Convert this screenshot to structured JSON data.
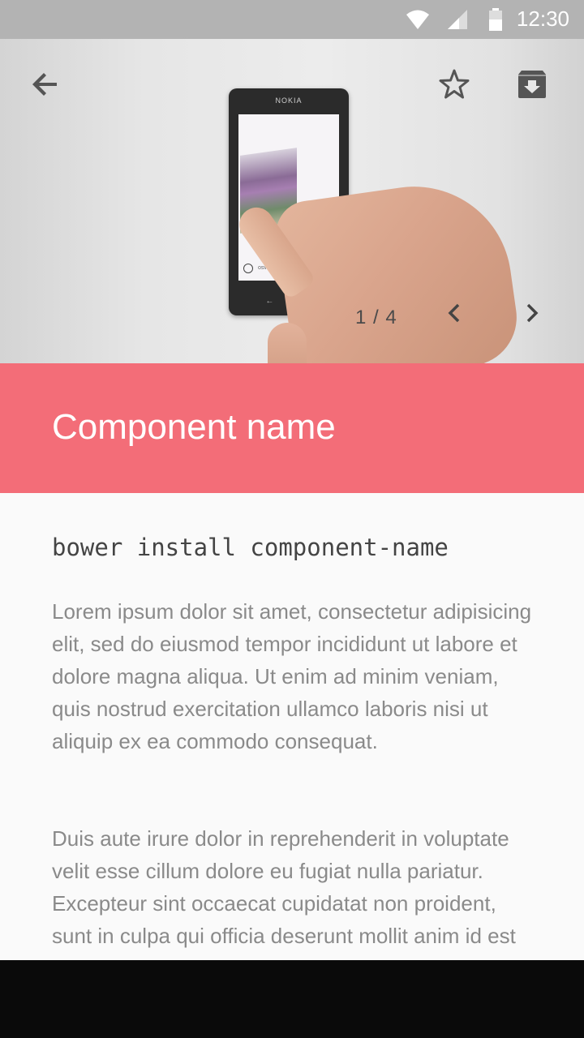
{
  "status_bar": {
    "time": "12:30"
  },
  "hero": {
    "phone_brand": "NOKIA",
    "phone_url": "osvaldas.info/examples/",
    "counter": "1 / 4"
  },
  "title": "Component name",
  "install_command": "bower install component-name",
  "paragraphs": [
    "Lorem ipsum dolor sit amet, consectetur adipisicing elit, sed do eiusmod tempor incididunt ut labore et dolore magna aliqua. Ut enim ad minim veniam, quis nostrud exercitation ullamco laboris nisi ut aliquip ex ea commodo consequat.",
    "Duis aute irure dolor in reprehenderit in voluptate velit esse cillum dolore eu fugiat nulla pariatur. Excepteur sint occaecat cupidatat non proident, sunt in culpa qui officia deserunt mollit anim id est laborum."
  ],
  "colors": {
    "accent": "#f36d78",
    "status_bar": "#b3b3b3",
    "nav_bar": "#0a0a0a"
  },
  "icons": [
    "wifi-icon",
    "signal-icon",
    "battery-icon",
    "back-arrow-icon",
    "star-outline-icon",
    "archive-icon",
    "chevron-left-icon",
    "chevron-right-icon"
  ]
}
